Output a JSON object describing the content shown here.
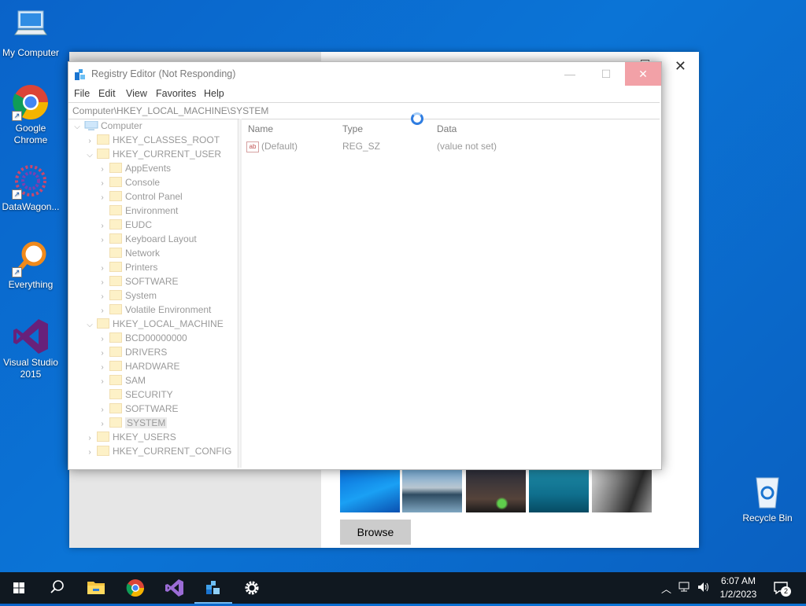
{
  "desktop": {
    "icons": [
      {
        "label": "My Computer"
      },
      {
        "label": "Google Chrome"
      },
      {
        "label": "DataWagon..."
      },
      {
        "label": "Everything"
      },
      {
        "label": "Visual Studio 2015"
      },
      {
        "label": "Recycle Bin"
      }
    ]
  },
  "settings": {
    "browse_label": "Browse",
    "close_glyph": "✕"
  },
  "regedit": {
    "title": "Registry Editor (Not Responding)",
    "min_glyph": "—",
    "max_glyph": "☐",
    "close_glyph": "✕",
    "menu": [
      "File",
      "Edit",
      "View",
      "Favorites",
      "Help"
    ],
    "address": "Computer\\HKEY_LOCAL_MACHINE\\SYSTEM",
    "tree": {
      "root": "Computer",
      "nodes": [
        "HKEY_CLASSES_ROOT",
        "HKEY_CURRENT_USER",
        "AppEvents",
        "Console",
        "Control Panel",
        "Environment",
        "EUDC",
        "Keyboard Layout",
        "Network",
        "Printers",
        "SOFTWARE",
        "System",
        "Volatile Environment",
        "HKEY_LOCAL_MACHINE",
        "BCD00000000",
        "DRIVERS",
        "HARDWARE",
        "SAM",
        "SECURITY",
        "SOFTWARE",
        "SYSTEM",
        "HKEY_USERS",
        "HKEY_CURRENT_CONFIG"
      ]
    },
    "columns": {
      "name": "Name",
      "type": "Type",
      "data": "Data"
    },
    "rows": [
      {
        "icon": "ab",
        "name": "(Default)",
        "type": "REG_SZ",
        "data": "(value not set)"
      }
    ]
  },
  "taskbar": {
    "time": "6:07 AM",
    "date": "1/2/2023",
    "notification_count": "2"
  }
}
